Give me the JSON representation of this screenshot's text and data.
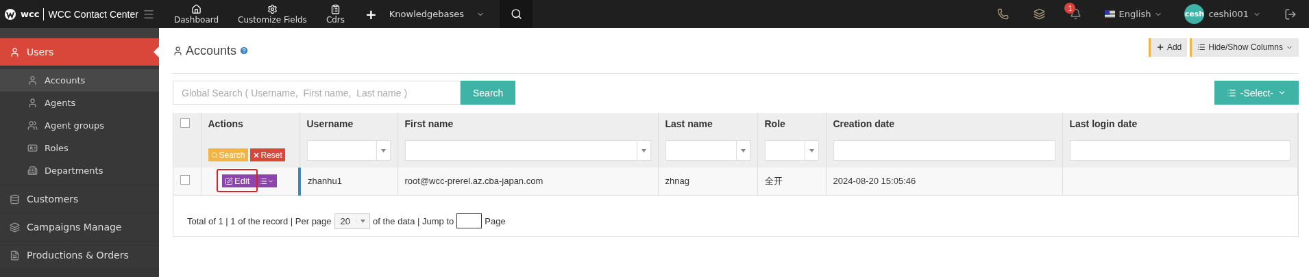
{
  "app": {
    "logo_text": "wcc",
    "title": "WCC Contact Center"
  },
  "nav": [
    {
      "label": "Dashboard"
    },
    {
      "label": "Customize Fields"
    },
    {
      "label": "Cdrs"
    }
  ],
  "nav_menu": {
    "plus": "+",
    "label": "Knowledgebases"
  },
  "notifications": {
    "count": "1"
  },
  "language": {
    "label": "English"
  },
  "user": {
    "avatar": "cesh",
    "name": "ceshi001"
  },
  "sidebar": [
    {
      "label": "Users",
      "selected": true,
      "children": [
        {
          "label": "Accounts",
          "selected": true
        },
        {
          "label": "Agents",
          "selected": false
        },
        {
          "label": "Agent groups",
          "selected": false
        },
        {
          "label": "Roles",
          "selected": false
        },
        {
          "label": "Departments",
          "selected": false
        }
      ]
    },
    {
      "label": "Customers",
      "selected": false
    },
    {
      "label": "Campaigns Manage",
      "selected": false
    },
    {
      "label": "Productions & Orders",
      "selected": false
    }
  ],
  "page": {
    "title": "Accounts",
    "buttons": [
      "Add",
      "Hide/Show Columns"
    ],
    "search": {
      "placeholder": "Global Search ( Username,  First name,  Last name )",
      "button": "Search"
    },
    "select_button": "-Select-"
  },
  "table": {
    "columns": [
      {
        "kind": "checkbox",
        "checked": false
      },
      {
        "kind": "actions",
        "label": "Actions",
        "search": "Search",
        "reset": "Reset"
      },
      {
        "kind": "select",
        "label": "Username"
      },
      {
        "kind": "select",
        "label": "First name"
      },
      {
        "kind": "select",
        "label": "Last name"
      },
      {
        "kind": "select",
        "label": "Role"
      },
      {
        "kind": "text",
        "label": "Creation date"
      },
      {
        "kind": "text",
        "label": "Last login date"
      }
    ],
    "rows": [
      {
        "cells": [
          {
            "kind": "checkbox",
            "checked": false
          },
          {
            "kind": "actions",
            "edit": "Edit",
            "highlighted": true
          },
          "zhanhu1",
          "root@wcc-prerel.az.cba-japan.com",
          "zhnag",
          "全开",
          "2024-08-20 15:05:46",
          ""
        ]
      }
    ]
  },
  "footer": {
    "total": "Total of 1 | 1 of the record | Per page",
    "per_page": "20",
    "of_data": "of the data | Jump to",
    "page": "Page"
  }
}
